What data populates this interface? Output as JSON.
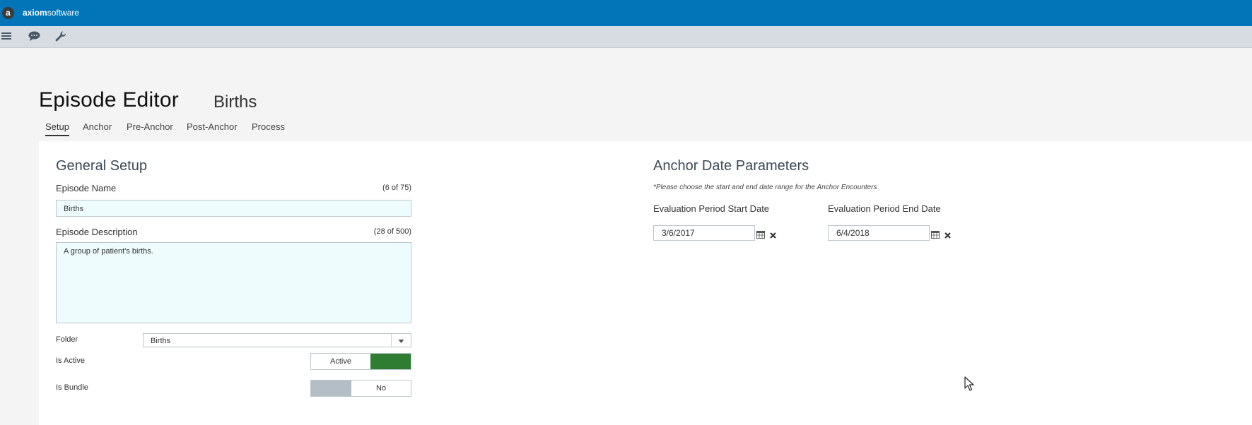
{
  "brand": {
    "mark": "a",
    "name_bold": "axiom",
    "name_rest": "software"
  },
  "toolbar": {
    "icons": [
      "menu-icon",
      "chat-icon",
      "wrench-icon"
    ]
  },
  "page": {
    "title": "Episode Editor",
    "episode_name": "Births"
  },
  "tabs": [
    {
      "label": "Setup",
      "active": true
    },
    {
      "label": "Anchor",
      "active": false
    },
    {
      "label": "Pre-Anchor",
      "active": false
    },
    {
      "label": "Post-Anchor",
      "active": false
    },
    {
      "label": "Process",
      "active": false
    }
  ],
  "general_setup": {
    "title": "General Setup",
    "episode_name_label": "Episode Name",
    "episode_name_counter": "(6 of 75)",
    "episode_name_value": "Births",
    "description_label": "Episode Description",
    "description_counter": "(28 of 500)",
    "description_value": "A group of patient's births.",
    "folder_label": "Folder",
    "folder_value": "Births",
    "is_active_label": "Is Active",
    "is_active_value": "Active",
    "is_bundle_label": "Is Bundle",
    "is_bundle_value": "No"
  },
  "anchor_date": {
    "title": "Anchor Date Parameters",
    "hint": "*Please choose the start and end date range for the Anchor Encounters",
    "start_label": "Evaluation Period Start Date",
    "start_value": "3/6/2017",
    "end_label": "Evaluation Period End Date",
    "end_value": "6/4/2018"
  },
  "colors": {
    "topbar": "#0275b8",
    "toolbar": "#d6dce2",
    "active_green": "#2e7d32",
    "bundle_grey": "#b4bec6",
    "input_bg": "#eefcfd"
  }
}
